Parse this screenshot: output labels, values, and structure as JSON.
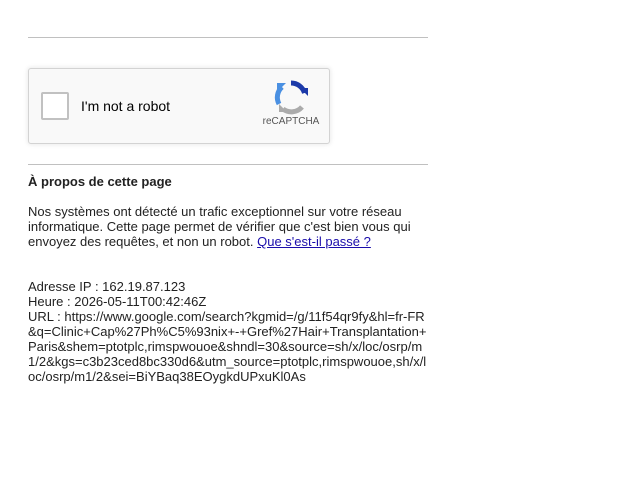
{
  "recaptcha": {
    "checkbox_label": "I'm not a robot",
    "brand": "reCAPTCHA",
    "checked": false
  },
  "about": {
    "title": "À propos de cette page",
    "text": "Nos systèmes ont détecté un trafic exceptionnel sur votre réseau informatique. Cette page permet de vérifier que c'est bien vous qui envoyez des requêtes, et non un robot. ",
    "link_label": "Que s'est-il passé ?"
  },
  "meta": {
    "ip_line": "Adresse IP : 162.19.87.123",
    "time_line": "Heure : 2026-05-11T00:42:46Z",
    "url_line": "URL : https://www.google.com/search?kgmid=/g/11f54qr9fy&hl=fr-FR&q=Clinic+Cap%27Ph%C5%93nix+-+Gref%27Hair+Transplantation+Paris&shem=ptotplc,rimspwouoe&shndl=30&source=sh/x/loc/osrp/m1/2&kgs=c3b23ced8bc330d6&utm_source=ptotplc,rimspwouoe,sh/x/loc/osrp/m1/2&sei=BiYBaq38EOygkdUPxuKl0As"
  },
  "colors": {
    "link": "#1a0dab",
    "text": "#222222",
    "recaptcha_blue_dark": "#1c3aa9",
    "recaptcha_blue": "#4a90e2",
    "recaptcha_gray": "#ababab"
  }
}
